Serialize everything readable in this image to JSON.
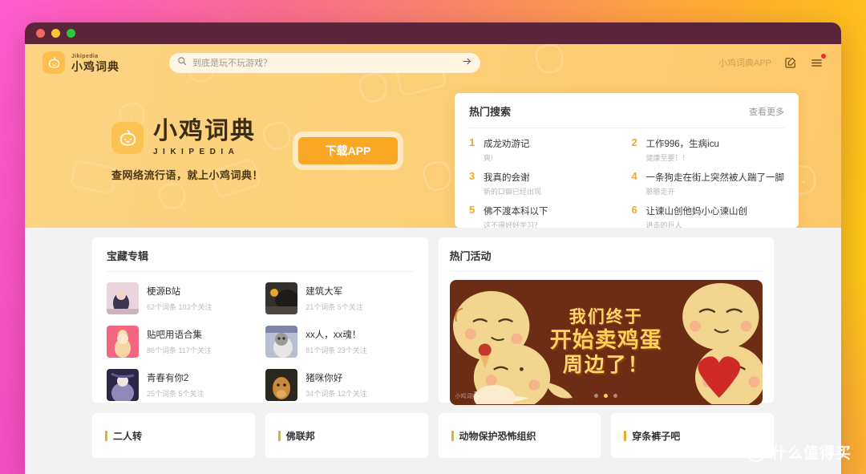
{
  "window": {
    "traffic_lights": [
      "close",
      "minimize",
      "maximize"
    ]
  },
  "header": {
    "brand_en": "Jikipedia",
    "brand_cn": "小鸡词典",
    "search_placeholder": "到底是玩不玩游戏？",
    "search_value": "",
    "app_link": "小鸡词典APP",
    "post_icon": "edit-square-icon",
    "menu_icon": "hamburger-menu-icon",
    "has_notification": true
  },
  "hero": {
    "title_cn": "小鸡词典",
    "title_en": "JIKIPEDIA",
    "tagline": "查网络流行语，就上小鸡词典！",
    "download_button": "下载APP"
  },
  "hot_search": {
    "title": "热门搜索",
    "more_label": "查看更多",
    "items": [
      {
        "rank": "1",
        "word": "成龙劝游记",
        "sub": "爽!"
      },
      {
        "rank": "2",
        "word": "工作996，生病icu",
        "sub": "健康至要！！"
      },
      {
        "rank": "3",
        "word": "我真的会谢",
        "sub": "新的口癖已经出现"
      },
      {
        "rank": "4",
        "word": "一条狗走在街上突然被人踹了一脚",
        "sub": "憨憨走开"
      },
      {
        "rank": "5",
        "word": "佛不渡本科以下",
        "sub": "这不得好好学习？"
      },
      {
        "rank": "6",
        "word": "让谏山创他妈小心谏山创",
        "sub": "进击的巨人"
      }
    ]
  },
  "albums": {
    "title": "宝藏专辑",
    "items": [
      {
        "name": "梗源B站",
        "meta": "62个词条  103个关注",
        "thumb_colors": [
          "#d8c3cf",
          "#f0dfe6"
        ]
      },
      {
        "name": "建筑大军",
        "meta": "21个词条  5个关注",
        "thumb_colors": [
          "#3a3a3c",
          "#6b6355"
        ]
      },
      {
        "name": "贴吧用语合集",
        "meta": "86个词条  117个关注",
        "thumb_colors": [
          "#f2667f",
          "#f7a8b8"
        ]
      },
      {
        "name": "xx人，xx魂！",
        "meta": "81个词条  23个关注",
        "thumb_colors": [
          "#8f97b5",
          "#cfd6e4"
        ]
      },
      {
        "name": "青春有你2",
        "meta": "25个词条  5个关注",
        "thumb_colors": [
          "#2b2747",
          "#6f6a99"
        ]
      },
      {
        "name": "猪咪你好",
        "meta": "34个词条  12个关注",
        "thumb_colors": [
          "#2e2a22",
          "#c98a3a"
        ]
      }
    ]
  },
  "activity": {
    "title": "热门活动",
    "banner": {
      "line1": "我们终于",
      "line2": "开始卖鸡蛋",
      "line3": "周边了！",
      "watermark": "小鸡词典",
      "bg_color": "#6d2d14",
      "text_color": "#ffd257",
      "dots": 3,
      "active_dot": 2
    }
  },
  "tag_cards": [
    {
      "name": "二人转"
    },
    {
      "name": "佛联邦"
    },
    {
      "name": "动物保护恐怖组织"
    },
    {
      "name": "穿条裤子吧"
    }
  ],
  "watermark": {
    "logo_char": "值",
    "text": "什么值得买"
  },
  "colors": {
    "accent": "#f5a623",
    "hero_bg": "#fcd078",
    "banner_bg": "#6d2d14",
    "page_bg": "#f2f2f2"
  }
}
